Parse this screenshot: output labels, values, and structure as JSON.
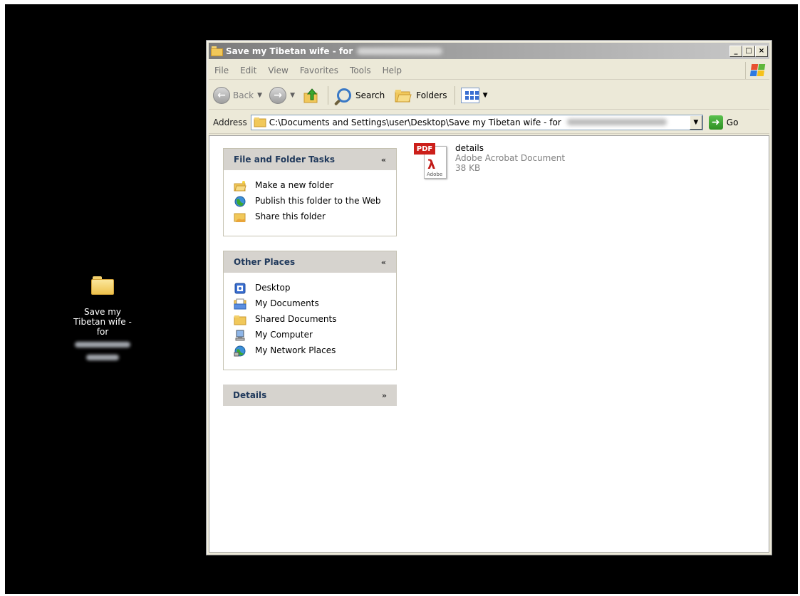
{
  "desktop": {
    "icon_label_lines": [
      "Save my",
      "Tibetan wife -",
      "for"
    ]
  },
  "window": {
    "title": "Save my Tibetan wife - for",
    "buttons": {
      "minimize": "_",
      "maximize": "□",
      "close": "×"
    }
  },
  "menubar": {
    "items": [
      "File",
      "Edit",
      "View",
      "Favorites",
      "Tools",
      "Help"
    ]
  },
  "toolbar": {
    "back_label": "Back",
    "search_label": "Search",
    "folders_label": "Folders"
  },
  "addressbar": {
    "label": "Address",
    "path": "C:\\Documents and Settings\\user\\Desktop\\Save my Tibetan wife - for",
    "go_label": "Go"
  },
  "taskpane": {
    "file_tasks": {
      "title": "File and Folder Tasks",
      "toggle": "«",
      "items": [
        "Make a new folder",
        "Publish this folder to the Web",
        "Share this folder"
      ]
    },
    "other_places": {
      "title": "Other Places",
      "toggle": "«",
      "items": [
        "Desktop",
        "My Documents",
        "Shared Documents",
        "My Computer",
        "My Network Places"
      ]
    },
    "details": {
      "title": "Details",
      "toggle": "»"
    }
  },
  "files": [
    {
      "name": "details",
      "type": "Adobe Acrobat Document",
      "size": "38 KB",
      "icon_tag": "PDF",
      "icon_brand": "Adobe"
    }
  ],
  "colors": {
    "desktop_bg": "#000000",
    "window_bg": "#ece9d8",
    "panel_header": "#d6d3ce",
    "panel_title": "#213a5c",
    "pdf_red": "#cc1f1a"
  }
}
